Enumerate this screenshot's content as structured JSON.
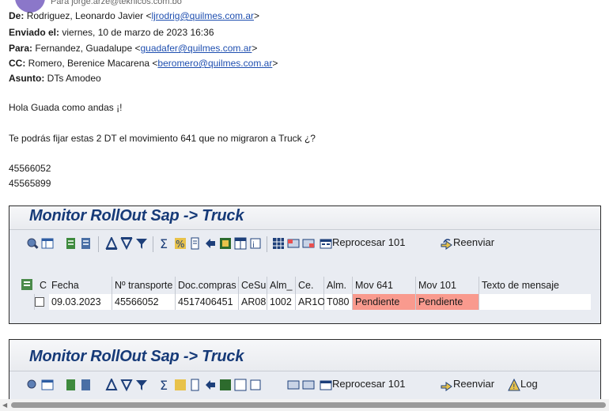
{
  "email": {
    "to_line": "Para   jorge.arze@teknicos.com.bo",
    "from_label": "De:",
    "from_name": "Rodriguez, Leonardo Javier <",
    "from_email": "ljrodrig@quilmes.com.ar",
    "from_close": ">",
    "sent_label": "Enviado el:",
    "sent_value": "viernes, 10 de marzo de 2023 16:36",
    "to_label": "Para:",
    "to_name": "Fernandez, Guadalupe <",
    "to_email": "guadafer@quilmes.com.ar",
    "to_close": ">",
    "cc_label": "CC:",
    "cc_name": "Romero, Berenice Macarena <",
    "cc_email": "beromero@quilmes.com.ar",
    "cc_close": ">",
    "subject_label": "Asunto:",
    "subject_value": "DTs Amodeo",
    "greeting": "Hola Guada como andas ¡!",
    "request": "Te podrás fijar estas 2 DT el movimiento 641 que no migraron a Truck ¿?",
    "dt1": "45566052",
    "dt2": "45565899"
  },
  "sap1": {
    "title": "Monitor RollOut Sap -> Truck",
    "reprocess_label": "Reprocesar 101",
    "resend_label": "Reenviar",
    "columns": [
      "C",
      "Fecha",
      "Nº transporte",
      "Doc.compras",
      "CeSu",
      "Alm_",
      "Ce.",
      "Alm.",
      "Mov 641",
      "Mov 101",
      "Texto de mensaje"
    ],
    "row": [
      "09.03.2023",
      "45566052",
      "4517406451",
      "AR08",
      "1002",
      "AR1O",
      "T080",
      "Pendiente",
      "Pendiente",
      ""
    ]
  },
  "sap2": {
    "title": "Monitor RollOut Sap -> Truck",
    "reprocess_label": "Reprocesar 101",
    "resend_label": "Reenviar",
    "log_label": "Log"
  },
  "colors": {
    "title_blue": "#163a78",
    "pending_red": "#f99a8e",
    "link_blue": "#1f4fb0"
  }
}
